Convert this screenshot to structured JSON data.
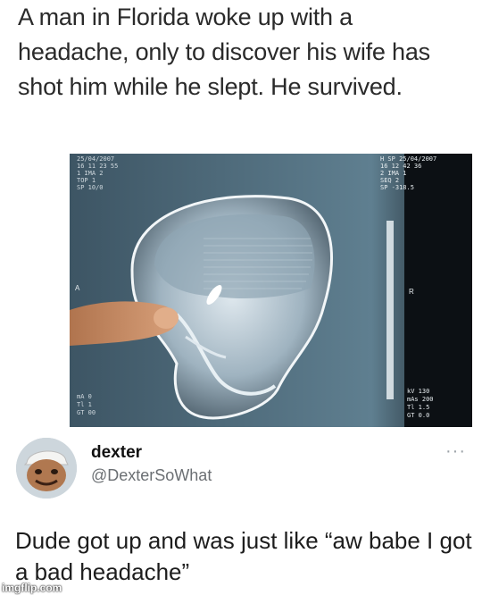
{
  "headline": "A man in Florida woke up with a headache, only to discover his wife has shot him while he slept. He survived.",
  "xray": {
    "info_left": [
      "25/04/2007",
      "16 11 23 55",
      "1 IMA 2",
      "TOP 1",
      "SP 10/0"
    ],
    "info_right": [
      "H SP 25/04/2007",
      "16 12 42 36",
      "2 IMA 1",
      "SEQ 2",
      "SP -318.5"
    ],
    "tech_left": [
      "mA 0",
      "Tl 1",
      "GT 00"
    ],
    "tech_right": [
      "kV 130",
      "mAs 200",
      "Tl 1.5",
      "GT 0.0"
    ],
    "marker_a": "A",
    "marker_r": "R"
  },
  "author": {
    "name": "dexter",
    "handle": "@DexterSoWhat",
    "more_icon": "···"
  },
  "tweet_text": "Dude got up and was just like “aw babe I got a bad headache”",
  "watermark": "imgflip.com"
}
